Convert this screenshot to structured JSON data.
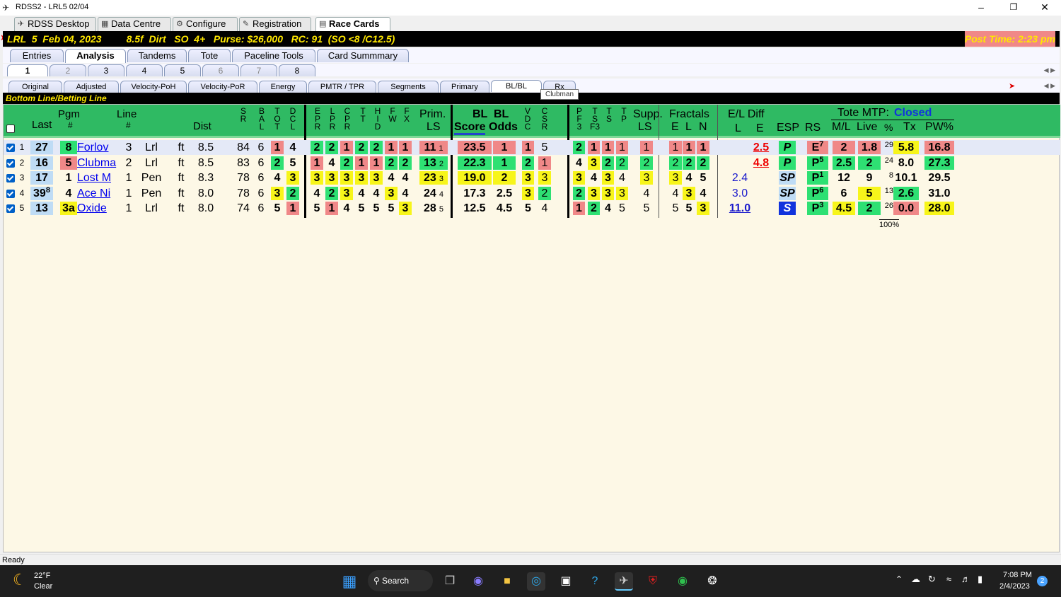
{
  "window": {
    "title": "RDSS2 - LRL5 02/04"
  },
  "top_tabs": [
    "RDSS Desktop",
    "Data Centre",
    "Configure",
    "Registration",
    "Race Cards"
  ],
  "race_header": {
    "left": "LRL  5  Feb 04, 2023         8.5f  Dirt   SO  4+   Purse: $26,000   RC: 91  (SO <8 /C12.5)",
    "right": "Post Time: 2:23 pm"
  },
  "section_tabs": [
    "Entries",
    "Analysis",
    "Tandems",
    "Tote",
    "Paceline Tools",
    "Card Summmary"
  ],
  "race_tabs": [
    "1",
    "2",
    "3",
    "4",
    "5",
    "6",
    "7",
    "8"
  ],
  "view_tabs": [
    "Original",
    "Adjusted",
    "Velocity-PoH",
    "Velocity-PoR",
    "Energy",
    "PMTR / TPR",
    "Segments",
    "Primary",
    "BL/BL",
    "Rx"
  ],
  "tooltip": "Clubman",
  "section_title": "Bottom Line/Betting Line",
  "headers": {
    "last": "Last",
    "pgm": "Pgm",
    "pgm_sub": "#",
    "line": "Line",
    "line_sub": "#",
    "dist": "Dist",
    "sr": [
      "S",
      "R"
    ],
    "bal": [
      "B",
      "A",
      "L"
    ],
    "tot": [
      "T",
      "O",
      "T"
    ],
    "dcl": [
      "D",
      "C",
      "L"
    ],
    "epr": [
      "E",
      "P",
      "R"
    ],
    "lpr": [
      "L",
      "P",
      "R"
    ],
    "cpr": [
      "C",
      "P",
      "R"
    ],
    "tt": [
      "T",
      "T"
    ],
    "hid": [
      "H",
      "I",
      "D"
    ],
    "fw": [
      "F",
      "W"
    ],
    "fx": [
      "F",
      "X"
    ],
    "prim": "Prim.",
    "prim2": "LS",
    "bl1": "BL",
    "bl2": "BL",
    "score": "Score",
    "odds": "Odds",
    "vdc": [
      "V",
      "D",
      "C"
    ],
    "csr": [
      "C",
      "S",
      "R"
    ],
    "pf3": [
      "P",
      "F",
      "3"
    ],
    "tsf3": [
      "T",
      "S",
      "F3"
    ],
    "ts": [
      "T",
      "S"
    ],
    "tp": [
      "T",
      "P"
    ],
    "supp": "Supp.",
    "supp2": "LS",
    "fractals": "Fractals",
    "f_e": "E",
    "f_l": "L",
    "f_n": "N",
    "eldiff": "E/L Diff",
    "eld_l": "L",
    "eld_e": "E",
    "esp": "ESP",
    "rs": "RS",
    "tote": "Tote MTP:",
    "tote_status": "Closed",
    "ml": "M/L",
    "live": "Live",
    "pct": "%",
    "tx": "Tx",
    "pw": "PW%"
  },
  "rows": [
    {
      "n": "1",
      "last": "27",
      "pgm": "8",
      "name": "Forlov",
      "line": "3",
      "trk": "Lrl",
      "cond": "ft",
      "dist": "8.5",
      "sr": "84",
      "bal": "6",
      "tot": "1",
      "dcl": "4",
      "epr": "2",
      "lpr": "2",
      "cpr": "1",
      "tt": "2",
      "hid": "2",
      "fw": "1",
      "fx": "1",
      "prim": "11",
      "prim_r": "1",
      "score": "23.5",
      "odds": "1",
      "vdc": "1",
      "csr": "5",
      "pf3": "2",
      "tsf3": "1",
      "ts": "1",
      "tp": "1",
      "supp": "1",
      "fe": "1",
      "fl": "1",
      "fn": "1",
      "eldl": "",
      "elde": "2.5",
      "esp": "P",
      "rs": "E",
      "rs_s": "7",
      "ml": "2",
      "live": "1.8",
      "pct": "29",
      "tx": "5.8",
      "pw": "16.8"
    },
    {
      "n": "2",
      "last": "16",
      "pgm": "5",
      "name": "Clubma",
      "line": "2",
      "trk": "Lrl",
      "cond": "ft",
      "dist": "8.5",
      "sr": "83",
      "bal": "6",
      "tot": "2",
      "dcl": "5",
      "epr": "1",
      "lpr": "4",
      "cpr": "2",
      "tt": "1",
      "hid": "1",
      "fw": "2",
      "fx": "2",
      "prim": "13",
      "prim_r": "2",
      "score": "22.3",
      "odds": "1",
      "vdc": "2",
      "csr": "1",
      "pf3": "4",
      "tsf3": "3",
      "ts": "2",
      "tp": "2",
      "supp": "2",
      "fe": "2",
      "fl": "2",
      "fn": "2",
      "eldl": "",
      "elde": "4.8",
      "esp": "P",
      "rs": "P",
      "rs_s": "5",
      "ml": "2.5",
      "live": "2",
      "pct": "24",
      "tx": "8.0",
      "pw": "27.3"
    },
    {
      "n": "3",
      "last": "17",
      "pgm": "1",
      "name": "Lost M",
      "line": "1",
      "trk": "Pen",
      "cond": "ft",
      "dist": "8.3",
      "sr": "78",
      "bal": "6",
      "tot": "4",
      "dcl": "3",
      "epr": "3",
      "lpr": "3",
      "cpr": "3",
      "tt": "3",
      "hid": "3",
      "fw": "4",
      "fx": "4",
      "prim": "23",
      "prim_r": "3",
      "score": "19.0",
      "odds": "2",
      "vdc": "3",
      "csr": "3",
      "pf3": "3",
      "tsf3": "4",
      "ts": "3",
      "tp": "4",
      "supp": "3",
      "fe": "3",
      "fl": "4",
      "fn": "5",
      "eldl": "2.4",
      "elde": "",
      "esp": "SP",
      "rs": "P",
      "rs_s": "1",
      "ml": "12",
      "live": "9",
      "pct": "8",
      "tx": "10.1",
      "pw": "29.5"
    },
    {
      "n": "4",
      "last": "39",
      "last_s": "8",
      "pgm": "4",
      "name": "Ace Ni",
      "line": "1",
      "trk": "Pen",
      "cond": "ft",
      "dist": "8.0",
      "sr": "78",
      "bal": "6",
      "tot": "3",
      "dcl": "2",
      "epr": "4",
      "lpr": "2",
      "cpr": "3",
      "tt": "4",
      "hid": "4",
      "fw": "3",
      "fx": "4",
      "prim": "24",
      "prim_r": "4",
      "score": "17.3",
      "odds": "2.5",
      "vdc": "3",
      "csr": "2",
      "pf3": "2",
      "tsf3": "3",
      "ts": "3",
      "tp": "3",
      "supp": "4",
      "fe": "4",
      "fl": "3",
      "fn": "4",
      "eldl": "3.0",
      "elde": "",
      "esp": "SP",
      "rs": "P",
      "rs_s": "6",
      "ml": "6",
      "live": "5",
      "pct": "13",
      "tx": "2.6",
      "pw": "31.0"
    },
    {
      "n": "5",
      "last": "13",
      "pgm": "3a",
      "name": "Oxide",
      "line": "1",
      "trk": "Lrl",
      "cond": "ft",
      "dist": "8.0",
      "sr": "74",
      "bal": "6",
      "tot": "5",
      "dcl": "1",
      "epr": "5",
      "lpr": "1",
      "cpr": "4",
      "tt": "5",
      "hid": "5",
      "fw": "5",
      "fx": "3",
      "prim": "28",
      "prim_r": "5",
      "score": "12.5",
      "odds": "4.5",
      "vdc": "5",
      "csr": "4",
      "pf3": "1",
      "tsf3": "2",
      "ts": "4",
      "tp": "5",
      "supp": "5",
      "fe": "5",
      "fl": "5",
      "fn": "3",
      "eldl": "11.0",
      "elde": "",
      "esp": "S",
      "rs": "P",
      "rs_s": "3",
      "ml": "4.5",
      "live": "2",
      "pct": "26",
      "tx": "0.0",
      "pw": "28.0"
    }
  ],
  "pct_total": "100%",
  "status": "Ready",
  "taskbar": {
    "weather_temp": "22°F",
    "weather_desc": "Clear",
    "search": "Search",
    "time": "7:08 PM",
    "date": "2/4/2023",
    "notif": "2"
  }
}
